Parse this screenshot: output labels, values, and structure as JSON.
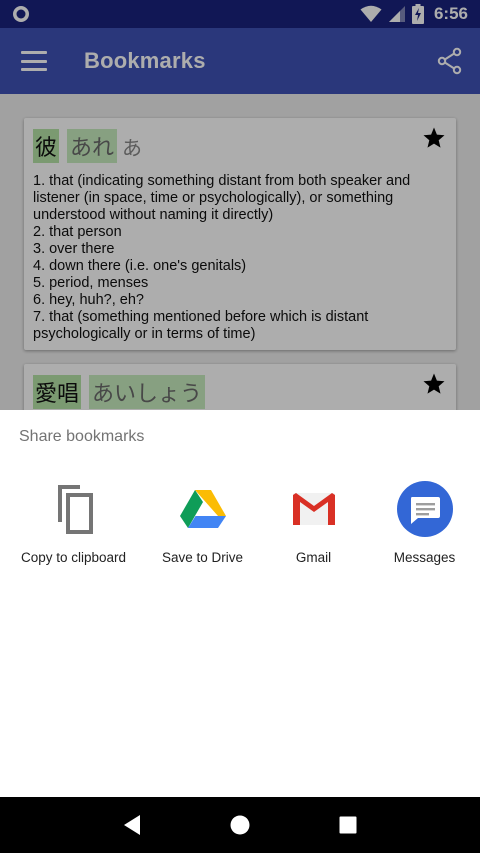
{
  "status_bar": {
    "time": "6:56",
    "icons": [
      "circle-notification-icon",
      "wifi-icon",
      "cell-signal-icon",
      "battery-charging-icon"
    ]
  },
  "app_bar": {
    "title": "Bookmarks",
    "icons": [
      "menu-icon",
      "share-icon"
    ]
  },
  "bookmarks": [
    {
      "kanji": "彼",
      "reading": "あれ",
      "alt_reading": "あ",
      "starred": true,
      "definition": "1. that (indicating something distant from both speaker and listener (in space, time or psychologically), or something understood without naming it directly)\n2. that person\n3. over there\n4. down there (i.e. one's genitals)\n5. period, menses\n6. hey, huh?, eh?\n7. that (something mentioned before which is distant psychologically or in terms of time)"
    },
    {
      "kanji": "愛唱",
      "reading": "あいしょう",
      "starred": true
    }
  ],
  "share_sheet": {
    "title": "Share bookmarks",
    "targets": [
      {
        "label": "Copy to clipboard",
        "icon": "copy-icon"
      },
      {
        "label": "Save to Drive",
        "icon": "drive-icon"
      },
      {
        "label": "Gmail",
        "icon": "gmail-icon"
      },
      {
        "label": "Messages",
        "icon": "messages-icon"
      }
    ]
  },
  "nav_bar": {
    "icons": [
      "back-icon",
      "home-icon",
      "recents-icon"
    ]
  },
  "colors": {
    "status_bar": "#1a237e",
    "app_bar": "#3f51b5",
    "highlight_kanji": "#b5e3a7",
    "highlight_reading": "#c8ecbf"
  }
}
